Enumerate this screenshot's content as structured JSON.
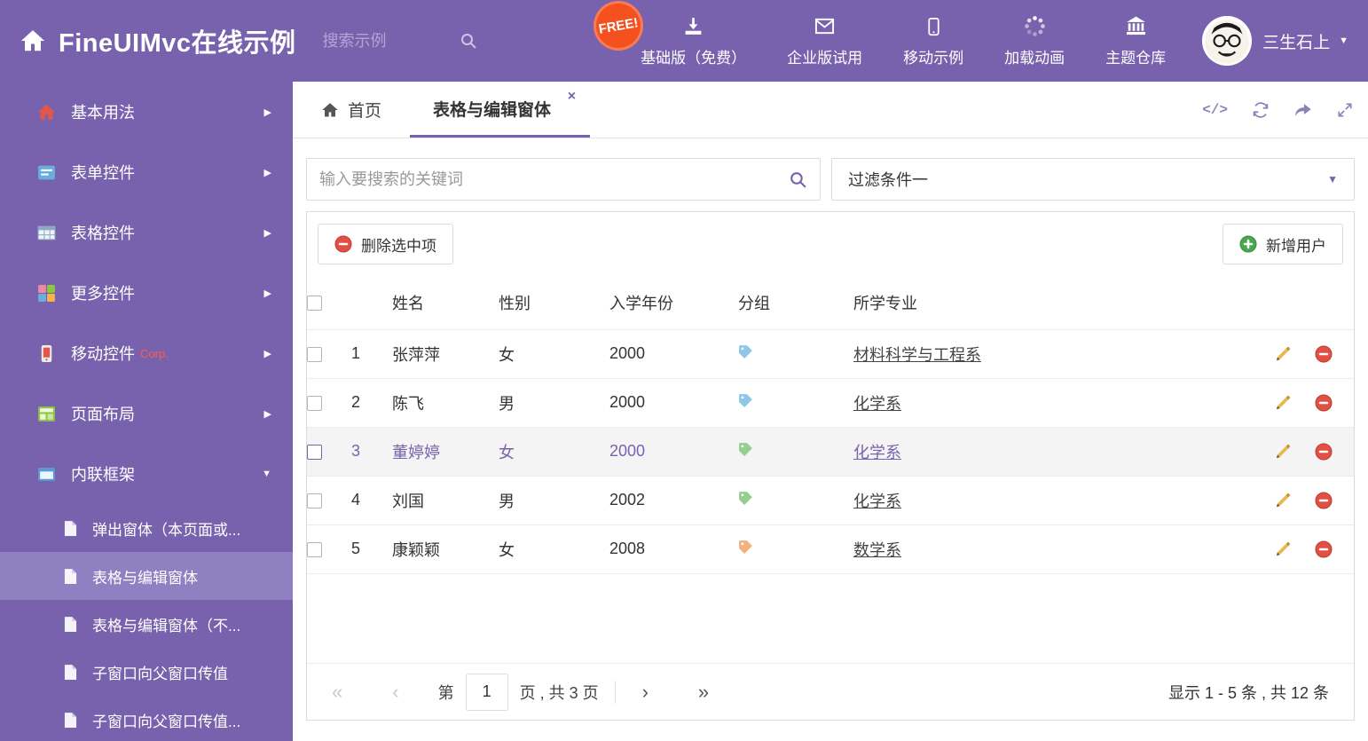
{
  "colors": {
    "primary": "#7862ad",
    "free_badge": "#f4511e",
    "danger": "#e25045",
    "success": "#49a84c",
    "selected_row_bg": "#f4f4f4"
  },
  "icons": {
    "caret_down": "▼",
    "chevron_right": "▶",
    "chevron_down": "▼",
    "close": "×",
    "code": "</>",
    "pager_first": "«",
    "pager_prev": "‹",
    "pager_next": "›",
    "pager_last": "»"
  },
  "header": {
    "title": "FineUIMvc在线示例",
    "search_placeholder": "搜索示例",
    "free_badge": "FREE!",
    "menu": [
      {
        "label": "基础版（免费）"
      },
      {
        "label": "企业版试用"
      },
      {
        "label": "移动示例"
      },
      {
        "label": "加载动画"
      },
      {
        "label": "主题仓库"
      }
    ],
    "username": "三生石上"
  },
  "sidebar": {
    "items": [
      {
        "label": "基本用法"
      },
      {
        "label": "表单控件"
      },
      {
        "label": "表格控件"
      },
      {
        "label": "更多控件"
      },
      {
        "label": "移动控件",
        "badge": "Corp."
      },
      {
        "label": "页面布局"
      },
      {
        "label": "内联框架"
      }
    ],
    "subitems": [
      {
        "label": "弹出窗体（本页面或..."
      },
      {
        "label": "表格与编辑窗体"
      },
      {
        "label": "表格与编辑窗体（不..."
      },
      {
        "label": "子窗口向父窗口传值"
      },
      {
        "label": "子窗口向父窗口传值..."
      }
    ]
  },
  "tabs": {
    "home_label": "首页",
    "active_label": "表格与编辑窗体"
  },
  "filters": {
    "search_placeholder": "输入要搜索的关键词",
    "dropdown_value": "过滤条件一"
  },
  "toolbar": {
    "delete_label": "删除选中项",
    "add_label": "新增用户"
  },
  "table": {
    "columns": {
      "name": "姓名",
      "gender": "性别",
      "year": "入学年份",
      "group": "分组",
      "major": "所学专业"
    },
    "rows": [
      {
        "index": "1",
        "name": "张萍萍",
        "gender": "女",
        "year": "2000",
        "tag_color": "#8ec7e8",
        "major": "材料科学与工程系"
      },
      {
        "index": "2",
        "name": "陈飞",
        "gender": "男",
        "year": "2000",
        "tag_color": "#8ec7e8",
        "major": "化学系"
      },
      {
        "index": "3",
        "name": "董婷婷",
        "gender": "女",
        "year": "2000",
        "tag_color": "#95cf8e",
        "major": "化学系"
      },
      {
        "index": "4",
        "name": "刘国",
        "gender": "男",
        "year": "2002",
        "tag_color": "#95cf8e",
        "major": "化学系"
      },
      {
        "index": "5",
        "name": "康颖颖",
        "gender": "女",
        "year": "2008",
        "tag_color": "#f2b27e",
        "major": "数学系"
      }
    ]
  },
  "pagination": {
    "page_word": "第",
    "page_value": "1",
    "suffix": "页 , 共 3 页",
    "summary": "显示 1 - 5 条 , 共 12 条"
  }
}
